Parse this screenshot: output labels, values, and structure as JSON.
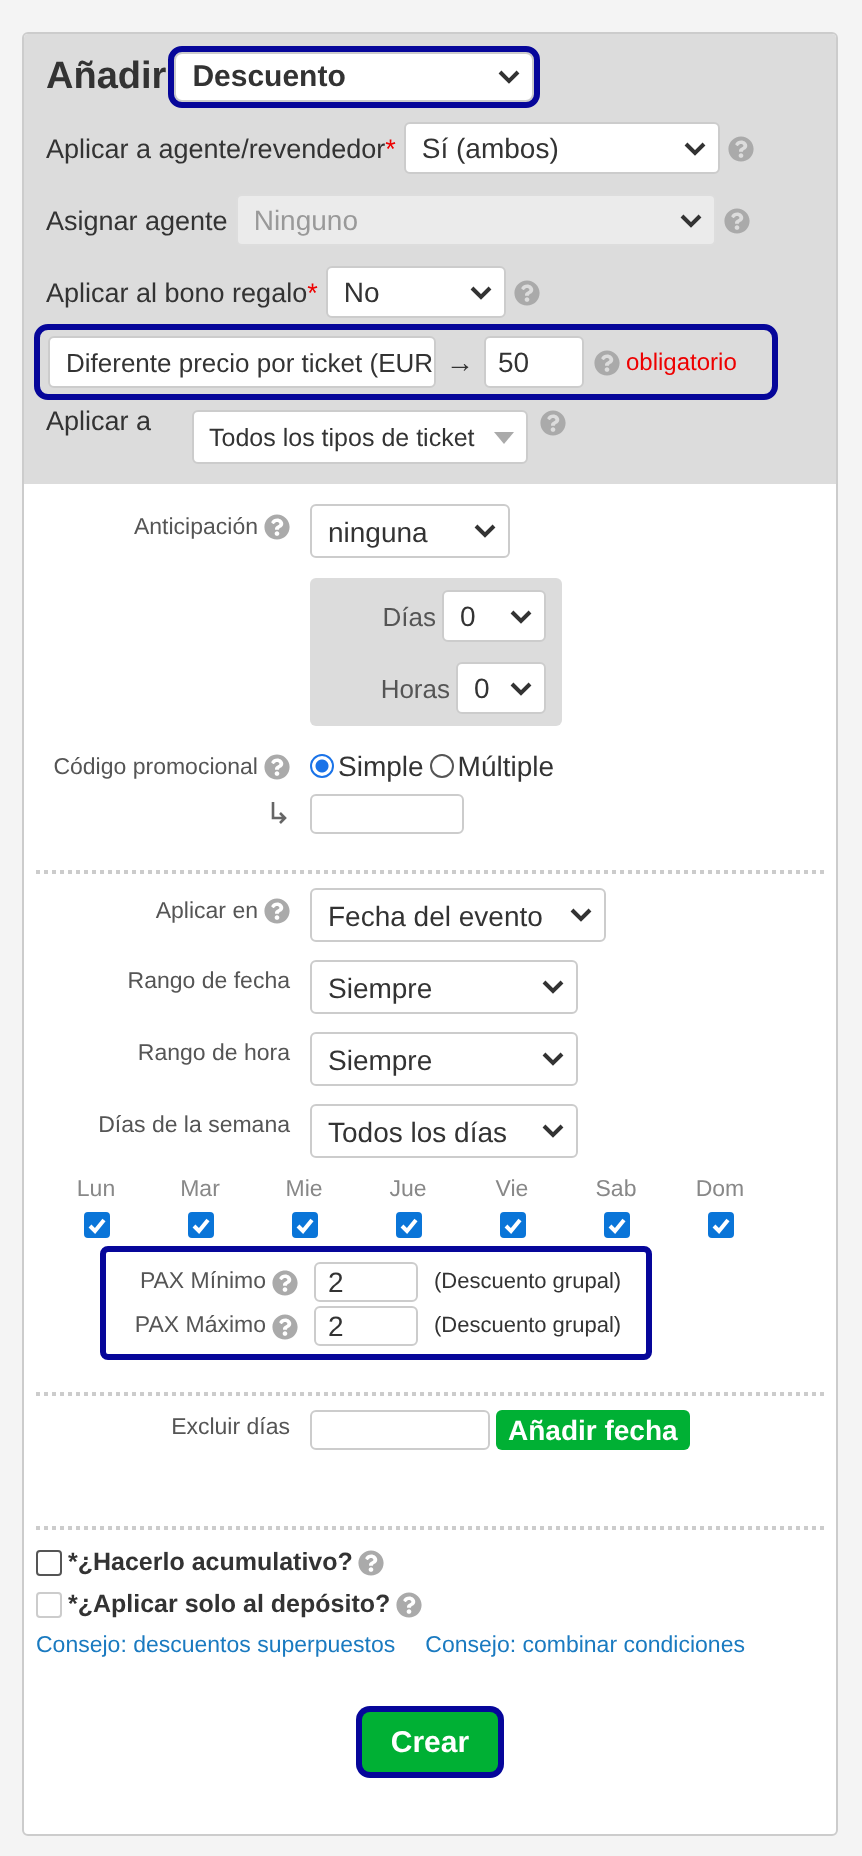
{
  "header": {
    "title": "Añadir",
    "type_select": {
      "value": "Descuento",
      "highlighted": true
    }
  },
  "header_fields": [
    {
      "label": "Aplicar a agente/revendedor",
      "required_mark": "*",
      "value": "Sí (ambos)",
      "disabled": false,
      "help": true
    },
    {
      "label": "Asignar agente",
      "value": "Ninguno",
      "disabled": true,
      "help": true
    },
    {
      "label": "Aplicar al bono regalo",
      "required_mark": "*",
      "value": "No",
      "disabled": false,
      "help": true
    }
  ],
  "price": {
    "highlighted": true,
    "select": "Diferente precio por ticket (EUR",
    "arrow": "→",
    "value": "50",
    "note": "obligatorio"
  },
  "apply_to": {
    "label": "Aplicar a",
    "value": "Todos los tipos de ticket"
  },
  "anticipation": {
    "label": "Anticipación",
    "value": "ninguna",
    "days": {
      "label": "Días",
      "value": "0"
    },
    "hours": {
      "label": "Horas",
      "value": "0"
    }
  },
  "promo": {
    "label": "Código promocional",
    "options": [
      {
        "label": "Simple",
        "selected": true
      },
      {
        "label": "Múltiple",
        "selected": false
      }
    ]
  },
  "conditions": [
    {
      "label": "Aplicar en",
      "value": "Fecha del evento",
      "help": true
    },
    {
      "label": "Rango de fecha",
      "value": "Siempre",
      "help": false
    },
    {
      "label": "Rango de hora",
      "value": "Siempre",
      "help": false
    },
    {
      "label": "Días de la semana",
      "value": "Todos los días",
      "help": false
    }
  ],
  "weekdays": [
    {
      "label": "Lun",
      "checked": true
    },
    {
      "label": "Mar",
      "checked": true
    },
    {
      "label": "Mie",
      "checked": true
    },
    {
      "label": "Jue",
      "checked": true
    },
    {
      "label": "Vie",
      "checked": true
    },
    {
      "label": "Sab",
      "checked": true
    },
    {
      "label": "Dom",
      "checked": true
    }
  ],
  "pax": {
    "highlighted": true,
    "rows": [
      {
        "label": "PAX Mínimo",
        "value": "2",
        "note": "(Descuento grupal)"
      },
      {
        "label": "PAX Máximo",
        "value": "2",
        "note": "(Descuento grupal)"
      }
    ]
  },
  "exclude": {
    "label": "Excluir días",
    "button": "Añadir fecha"
  },
  "options": [
    {
      "label": "*¿Hacerlo acumulativo?",
      "checked": false,
      "disabled": false
    },
    {
      "label": "*¿Aplicar solo al depósito?",
      "checked": false,
      "disabled": true
    }
  ],
  "links": [
    "Consejo: descuentos superpuestos",
    "Consejo: combinar condiciones"
  ],
  "submit": {
    "label": "Crear",
    "highlighted": true
  }
}
